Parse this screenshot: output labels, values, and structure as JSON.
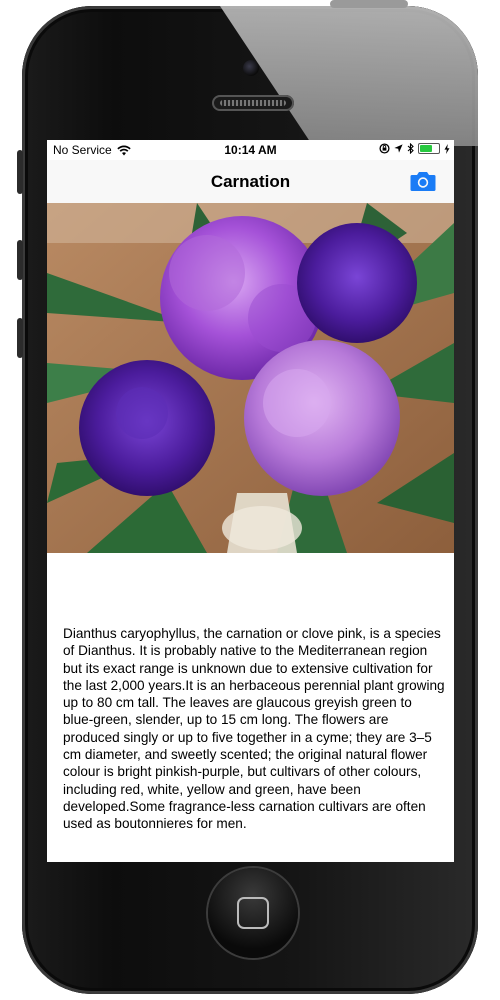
{
  "status_bar": {
    "carrier": "No Service",
    "time": "10:14 AM",
    "battery_color": "#27c93f"
  },
  "nav_bar": {
    "title": "Carnation",
    "camera_icon": "camera-icon",
    "accent_color": "#1a7cf6"
  },
  "main": {
    "description": "Dianthus caryophyllus, the carnation or clove pink, is a species of Dianthus. It is probably native to the Mediterranean region but its exact range is unknown due to extensive cultivation for the last 2,000 years.It is an herbaceous perennial plant growing up to 80 cm tall. The leaves are glaucous greyish green to blue-green, slender, up to 15 cm long. The flowers are produced singly or up to five together in a cyme; they are 3–5 cm diameter, and sweetly scented; the original natural flower colour is bright pinkish-purple, but cultivars of other colours, including red, white, yellow and green, have been developed.Some fragrance-less carnation cultivars are often used as boutonnieres for men."
  }
}
